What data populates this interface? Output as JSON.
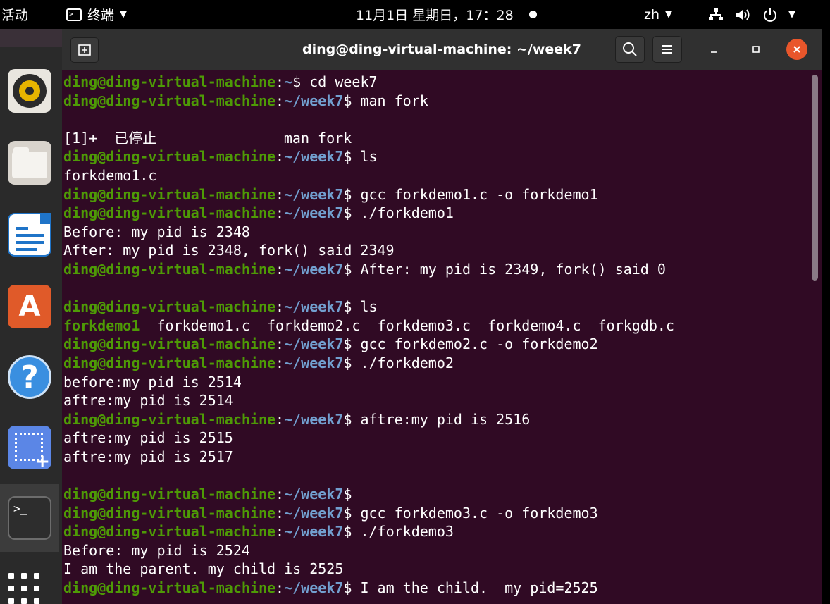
{
  "topbar": {
    "activities": "活动",
    "app_menu": "终端",
    "clock": "11月1日 星期日，17：28",
    "lang": "zh"
  },
  "window": {
    "title": "ding@ding-virtual-machine: ~/week7"
  },
  "terminal": {
    "user": "ding@ding-virtual-machine",
    "home_path": "~",
    "path": "~/week7",
    "lines": [
      {
        "type": "prompt",
        "home": true,
        "cmd": " cd week7"
      },
      {
        "type": "prompt",
        "cmd": " man fork"
      },
      {
        "type": "blank"
      },
      {
        "type": "out",
        "text": "[1]+  已停止               man fork"
      },
      {
        "type": "prompt",
        "cmd": " ls"
      },
      {
        "type": "out",
        "text": "forkdemo1.c"
      },
      {
        "type": "prompt",
        "cmd": " gcc forkdemo1.c -o forkdemo1"
      },
      {
        "type": "prompt",
        "cmd": " ./forkdemo1"
      },
      {
        "type": "out",
        "text": "Before: my pid is 2348"
      },
      {
        "type": "out",
        "text": "After: my pid is 2348, fork() said 2349"
      },
      {
        "type": "prompt",
        "cmd": " After: my pid is 2349, fork() said 0"
      },
      {
        "type": "blank"
      },
      {
        "type": "prompt",
        "cmd": " ls"
      },
      {
        "type": "ls",
        "exe": "forkdemo1",
        "rest": "  forkdemo1.c  forkdemo2.c  forkdemo3.c  forkdemo4.c  forkgdb.c"
      },
      {
        "type": "prompt",
        "cmd": " gcc forkdemo2.c -o forkdemo2"
      },
      {
        "type": "prompt",
        "cmd": " ./forkdemo2"
      },
      {
        "type": "out",
        "text": "before:my pid is 2514"
      },
      {
        "type": "out",
        "text": "aftre:my pid is 2514"
      },
      {
        "type": "prompt",
        "cmd": " aftre:my pid is 2516"
      },
      {
        "type": "out",
        "text": "aftre:my pid is 2515"
      },
      {
        "type": "out",
        "text": "aftre:my pid is 2517"
      },
      {
        "type": "blank"
      },
      {
        "type": "prompt",
        "cmd": ""
      },
      {
        "type": "prompt",
        "cmd": " gcc forkdemo3.c -o forkdemo3"
      },
      {
        "type": "prompt",
        "cmd": " ./forkdemo3"
      },
      {
        "type": "out",
        "text": "Before: my pid is 2524"
      },
      {
        "type": "out",
        "text": "I am the parent. my child is 2525"
      },
      {
        "type": "prompt",
        "cmd": " I am the child.  my pid=2525"
      }
    ]
  },
  "colors": {
    "terminal_bg": "#300a24",
    "prompt_user": "#4e9a06",
    "prompt_path": "#729fcf",
    "close_button": "#e9562b"
  },
  "icons": [
    "terminal-icon",
    "rhythmbox-icon",
    "files-icon",
    "writer-icon",
    "software-icon",
    "help-icon",
    "screenshot-icon",
    "show-apps-icon",
    "search-icon",
    "menu-icon",
    "network-icon",
    "volume-icon",
    "power-icon"
  ]
}
